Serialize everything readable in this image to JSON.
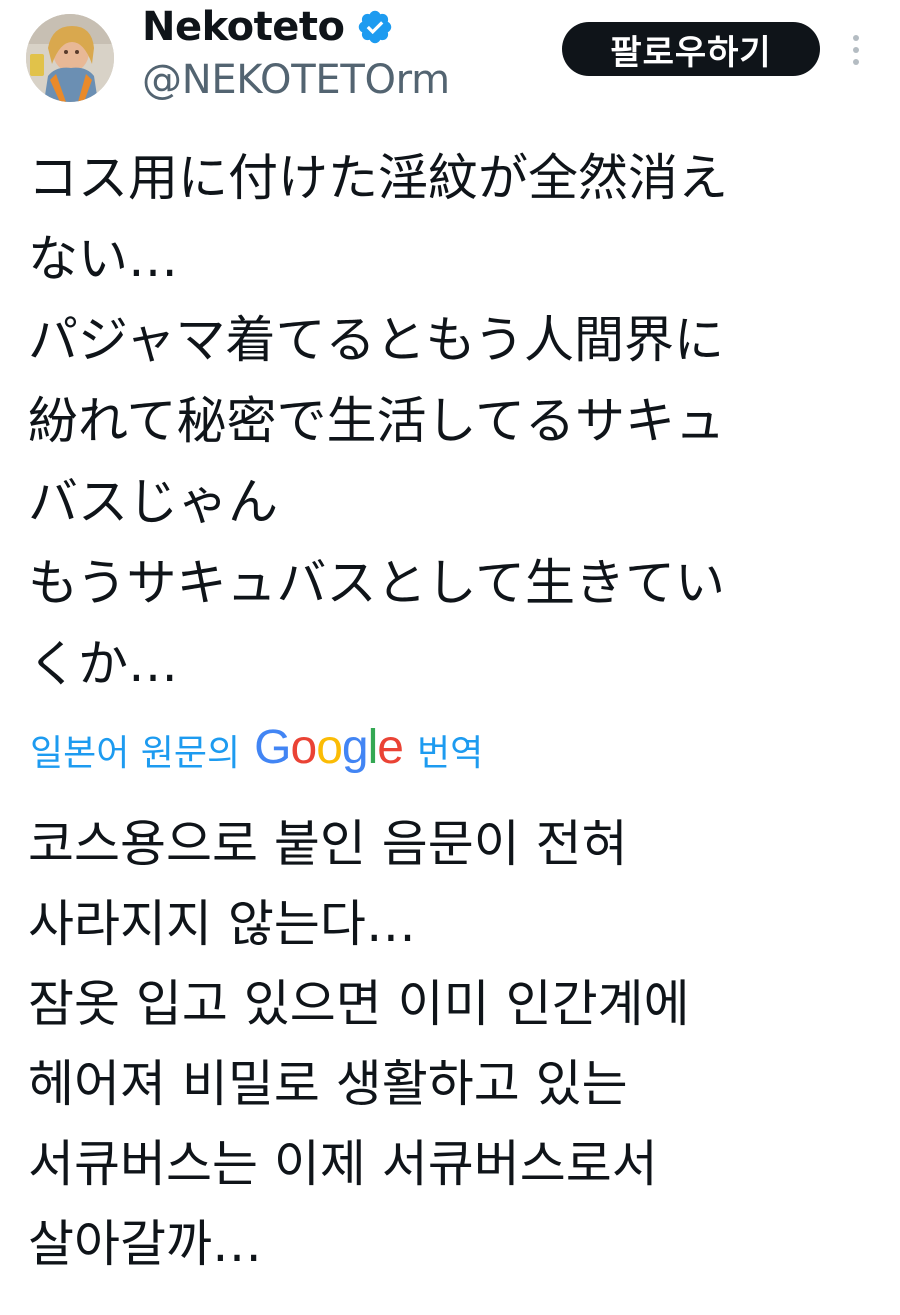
{
  "author": {
    "display_name": "Nekoteto",
    "handle": "@NEKOTETOrm",
    "verified_icon": "verified-badge-icon"
  },
  "actions": {
    "follow_label": "팔로우하기",
    "more_icon": "more-vertical-icon"
  },
  "tweet": {
    "lines": [
      "コス用に付けた淫紋が全然消え",
      "ない…",
      "パジャマ着てるともう人間界に",
      "紛れて秘密で生活してるサキュ",
      "バスじゃん",
      "もうサキュバスとして生きてい",
      "くか…"
    ]
  },
  "translation": {
    "prefix": "일본어 원문의",
    "logo_letters": [
      "G",
      "o",
      "o",
      "g",
      "l",
      "e"
    ],
    "suffix": "번역",
    "lines": [
      "코스용으로 붙인 음문이 전혀",
      "사라지지 않는다…",
      "잠옷 입고 있으면 이미 인간계에",
      "헤어져 비밀로 생활하고 있는",
      "서큐버스는 이제 서큐버스로서",
      "살아갈까…"
    ]
  },
  "colors": {
    "link_blue": "#1d9bf0",
    "verified_blue": "#1d9bf0",
    "text": "#0f1419",
    "secondary_text": "#536471",
    "button_bg": "#0f1419"
  }
}
